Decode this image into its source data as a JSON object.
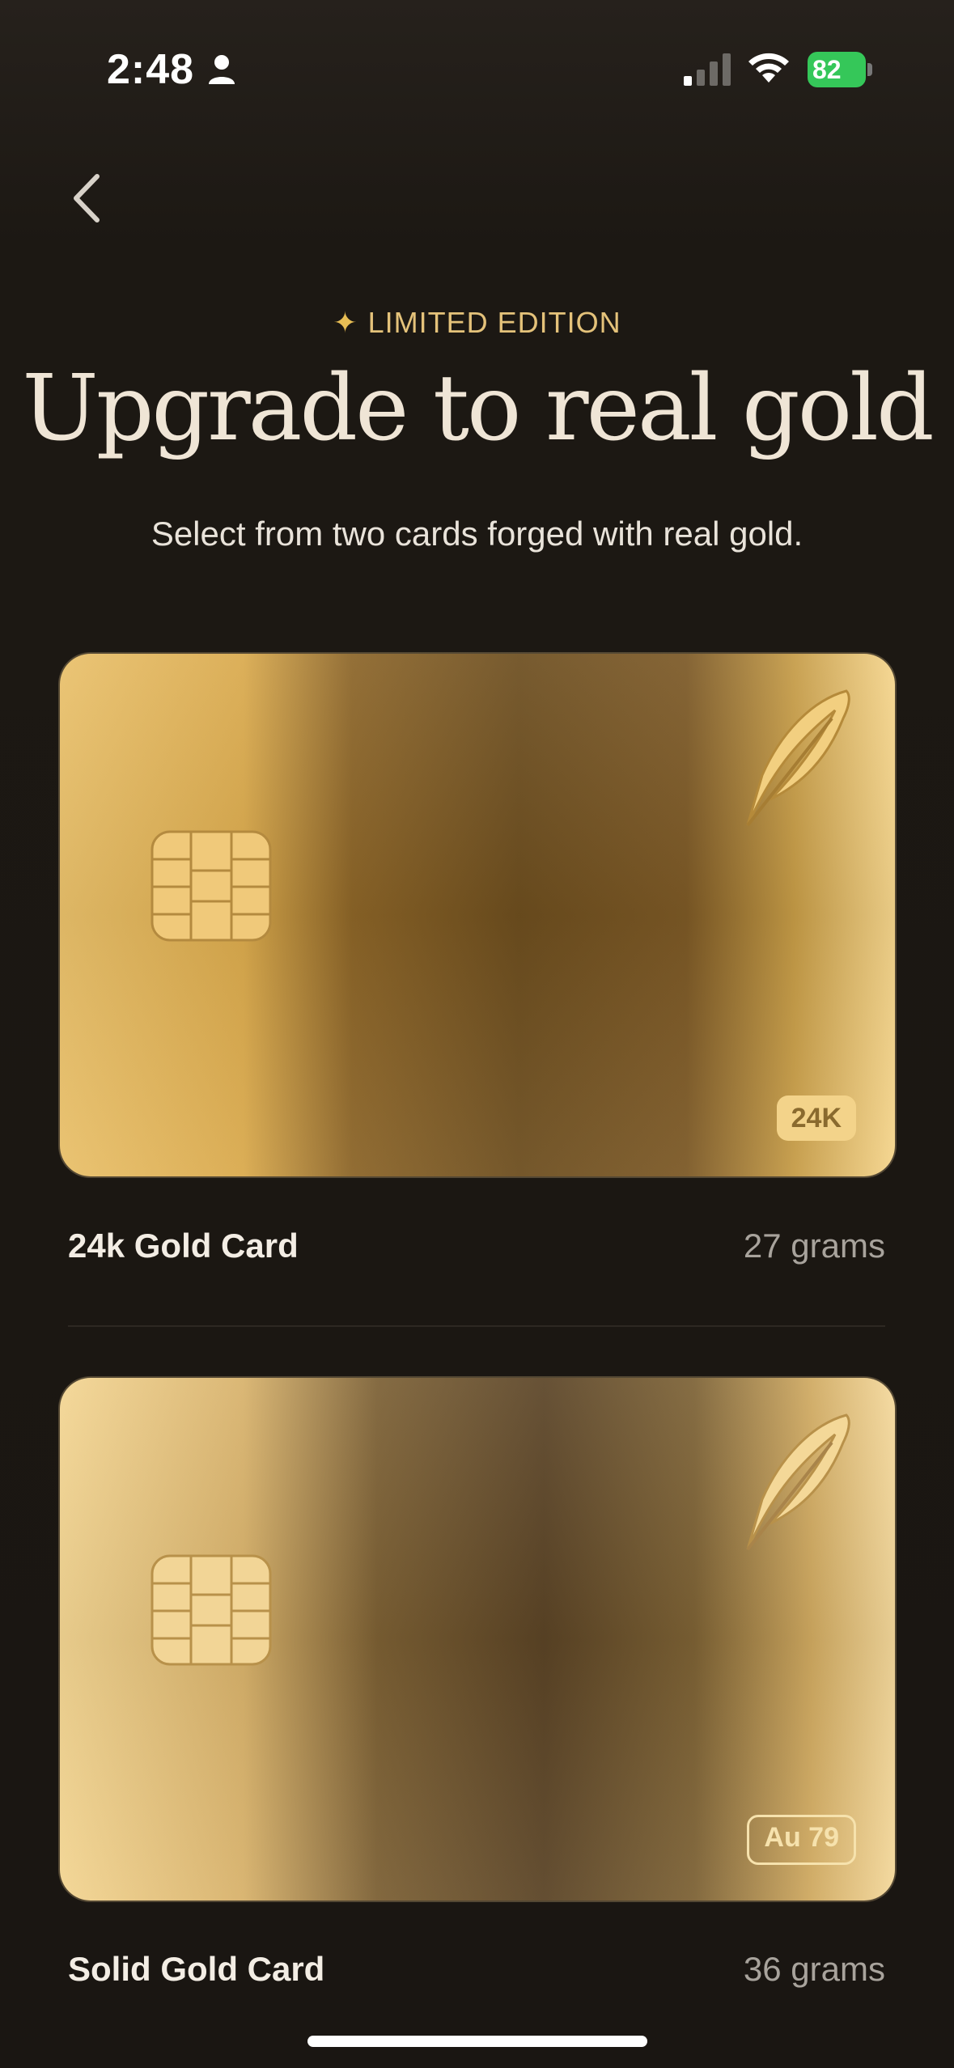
{
  "status_bar": {
    "time": "2:48",
    "battery": "82"
  },
  "header": {
    "eyebrow_icon": "sparkle-icon",
    "eyebrow": "LIMITED EDITION",
    "title": "Upgrade to real gold",
    "subtitle": "Select from two cards forged with real gold."
  },
  "cards": [
    {
      "name": "24k Gold Card",
      "weight": "27 grams",
      "badge": "24K"
    },
    {
      "name": "Solid Gold Card",
      "weight": "36 grams",
      "badge": "Au 79"
    }
  ],
  "colors": {
    "accent": "#e4c27a",
    "background": "#1c1813",
    "battery": "#35c759"
  }
}
